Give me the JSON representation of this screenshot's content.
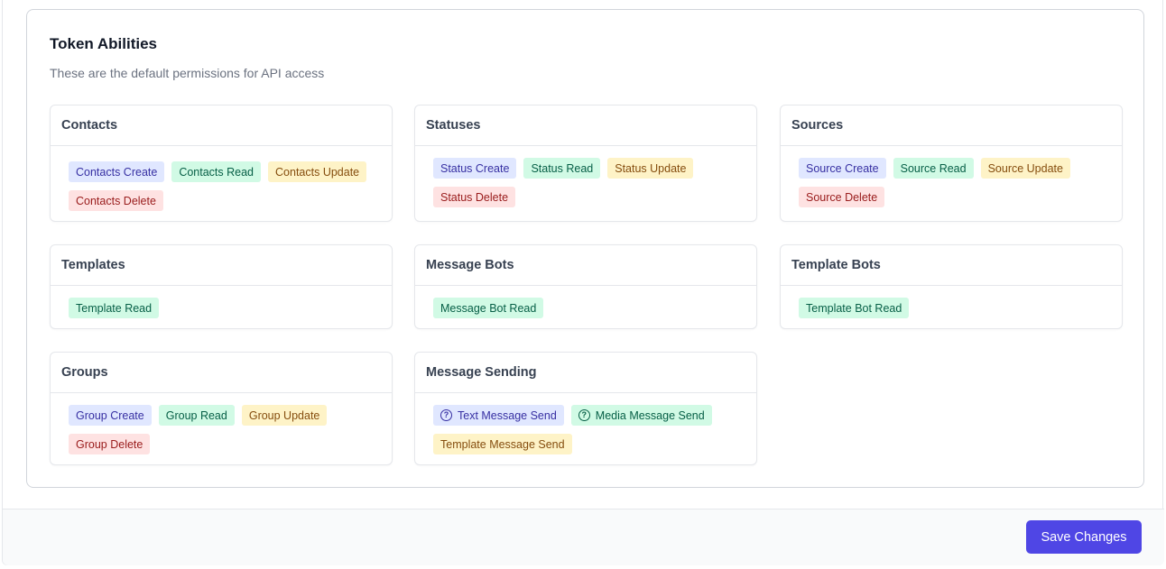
{
  "section": {
    "title": "Token Abilities",
    "subtitle": "These are the default permissions for API access"
  },
  "groups": [
    {
      "title": "Contacts",
      "pills": [
        {
          "label": "Contacts Create",
          "color": "indigo"
        },
        {
          "label": "Contacts Read",
          "color": "green"
        },
        {
          "label": "Contacts Update",
          "color": "yellow"
        },
        {
          "label": "Contacts Delete",
          "color": "red"
        }
      ]
    },
    {
      "title": "Statuses",
      "pills": [
        {
          "label": "Status Create",
          "color": "indigo"
        },
        {
          "label": "Status Read",
          "color": "green"
        },
        {
          "label": "Status Update",
          "color": "yellow"
        },
        {
          "label": "Status Delete",
          "color": "red"
        }
      ]
    },
    {
      "title": "Sources",
      "pills": [
        {
          "label": "Source Create",
          "color": "indigo"
        },
        {
          "label": "Source Read",
          "color": "green"
        },
        {
          "label": "Source Update",
          "color": "yellow"
        },
        {
          "label": "Source Delete",
          "color": "red"
        }
      ]
    },
    {
      "title": "Templates",
      "pills": [
        {
          "label": "Template Read",
          "color": "green"
        }
      ]
    },
    {
      "title": "Message Bots",
      "pills": [
        {
          "label": "Message Bot Read",
          "color": "green"
        }
      ]
    },
    {
      "title": "Template Bots",
      "pills": [
        {
          "label": "Template Bot Read",
          "color": "green"
        }
      ]
    },
    {
      "title": "Groups",
      "pills": [
        {
          "label": "Group Create",
          "color": "indigo"
        },
        {
          "label": "Group Read",
          "color": "green"
        },
        {
          "label": "Group Update",
          "color": "yellow"
        },
        {
          "label": "Group Delete",
          "color": "red"
        }
      ]
    },
    {
      "title": "Message Sending",
      "pills": [
        {
          "label": "Text Message Send",
          "color": "indigo",
          "icon": "question-circle-icon"
        },
        {
          "label": "Media Message Send",
          "color": "green",
          "icon": "question-circle-icon"
        },
        {
          "label": "Template Message Send",
          "color": "yellow"
        }
      ]
    }
  ],
  "footer": {
    "save_label": "Save Changes"
  },
  "colors": {
    "accent": "#4f46e5",
    "indigo_bg": "#e0e7ff",
    "green_bg": "#d1fae5",
    "yellow_bg": "#fef3c7",
    "red_bg": "#fee2e2"
  }
}
